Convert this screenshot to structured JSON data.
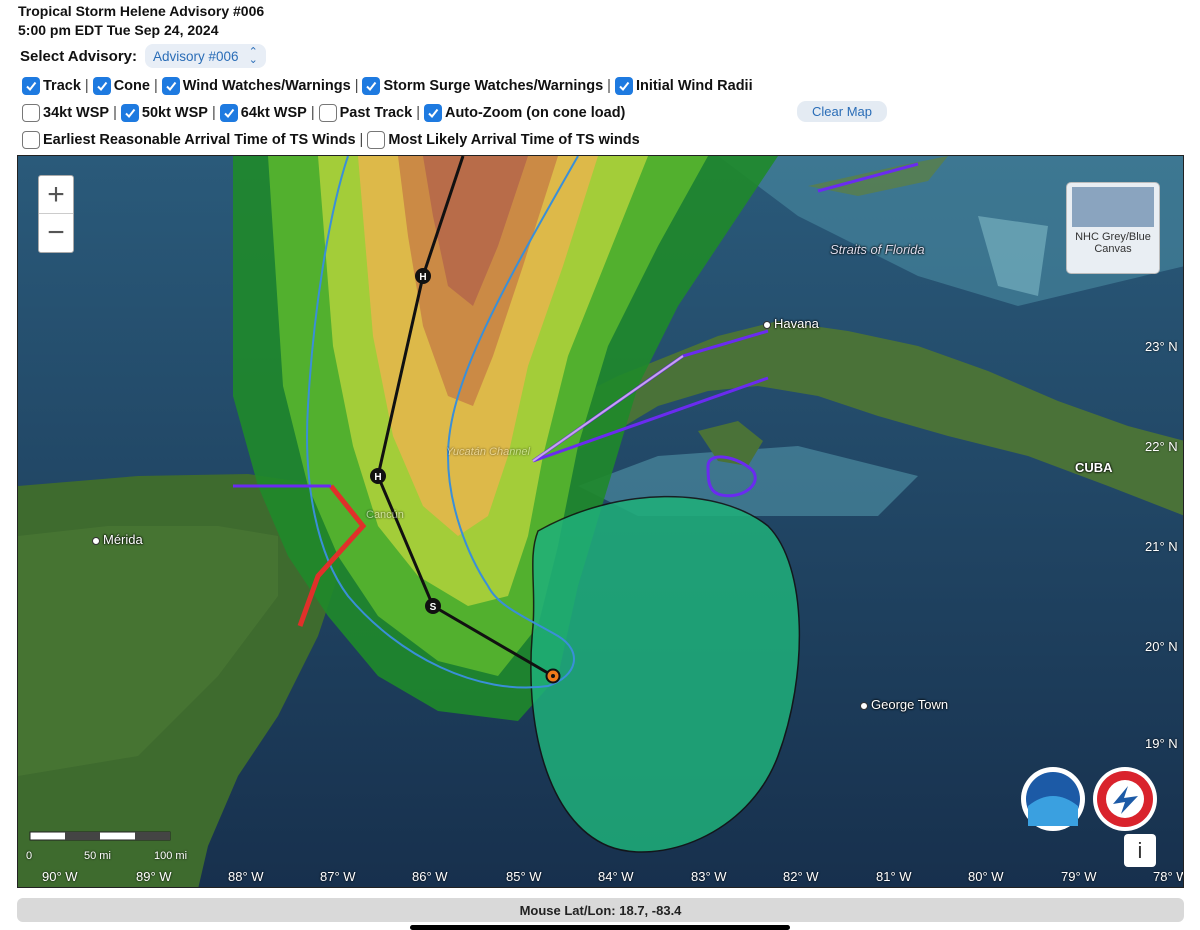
{
  "header": {
    "title_line1": "Tropical Storm Helene Advisory #006",
    "title_line2": "5:00 pm EDT Tue Sep 24, 2024",
    "select_label": "Select Advisory:",
    "select_value": "Advisory #006"
  },
  "options": {
    "track": {
      "label": "Track",
      "checked": true
    },
    "cone": {
      "label": "Cone",
      "checked": true
    },
    "wind_watches": {
      "label": "Wind Watches/Warnings",
      "checked": true
    },
    "surge_watches": {
      "label": "Storm Surge Watches/Warnings",
      "checked": true
    },
    "initial_radii": {
      "label": "Initial Wind Radii",
      "checked": true
    },
    "wsp34": {
      "label": "34kt WSP",
      "checked": false
    },
    "wsp50": {
      "label": "50kt WSP",
      "checked": true
    },
    "wsp64": {
      "label": "64kt WSP",
      "checked": true
    },
    "past_track": {
      "label": "Past Track",
      "checked": false
    },
    "auto_zoom": {
      "label": "Auto-Zoom (on cone load)",
      "checked": true
    },
    "earliest_arrival": {
      "label": "Earliest Reasonable Arrival Time of TS Winds",
      "checked": false
    },
    "likely_arrival": {
      "label": "Most Likely Arrival Time of TS winds",
      "checked": false
    },
    "clear_label": "Clear Map"
  },
  "map": {
    "zoom_in": "+",
    "zoom_out": "−",
    "basemap_button": "NHC Grey/Blue Canvas",
    "info_label": "i",
    "places": {
      "straits": "Straits of Florida",
      "havana": "Havana",
      "cuba": "CUBA",
      "merida": "Mérida",
      "george_town": "George Town",
      "cancun": "Cancún",
      "yucatan_channel": "Yucatán Channel"
    },
    "track_markers": [
      "H",
      "H",
      "S"
    ],
    "lat_labels": [
      "23° N",
      "22° N",
      "21° N",
      "20° N",
      "19° N"
    ],
    "lon_labels": [
      "90° W",
      "89° W",
      "88° W",
      "87° W",
      "86° W",
      "85° W",
      "84° W",
      "83° W",
      "82° W",
      "81° W",
      "80° W",
      "79° W",
      "78° W"
    ],
    "scale_left": "0",
    "scale_mid": "50 mi",
    "scale_right": "100 mi",
    "colors": {
      "cone": "#3a8fd8",
      "track": "#111111",
      "warning_red": "#e0302a",
      "watch_purple": "#6a2bf0",
      "radii": "#1fb07a"
    }
  },
  "status": {
    "mouse_label": "Mouse Lat/Lon:",
    "mouse_value": "18.7, -83.4"
  }
}
